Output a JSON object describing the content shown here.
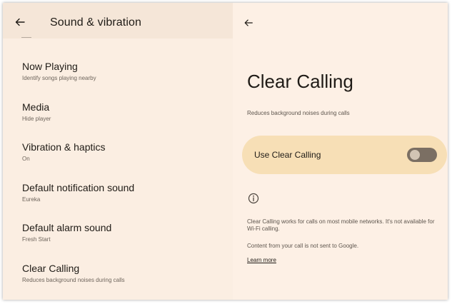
{
  "left_pane": {
    "title": "Sound & vibration",
    "items": [
      {
        "title": "Now Playing",
        "subtitle": "Identify songs playing nearby"
      },
      {
        "title": "Media",
        "subtitle": "Hide player"
      },
      {
        "title": "Vibration & haptics",
        "subtitle": "On"
      },
      {
        "title": "Default notification sound",
        "subtitle": "Eureka"
      },
      {
        "title": "Default alarm sound",
        "subtitle": "Fresh Start"
      },
      {
        "title": "Clear Calling",
        "subtitle": "Reduces background noises during calls"
      }
    ]
  },
  "right_pane": {
    "title": "Clear Calling",
    "description": "Reduces background noises during calls",
    "toggle": {
      "label": "Use Clear Calling",
      "state": "off"
    },
    "info_text": "Clear Calling works for calls on most mobile networks. It's not available for Wi-Fi calling.",
    "info_text_2": "Content from your call is not sent to Google.",
    "learn_more": "Learn more"
  },
  "icons": {
    "back": "arrow-back-icon",
    "info": "info-icon"
  },
  "colors": {
    "background": "#fbeee2",
    "header": "#f5e6d8",
    "toggle_card": "#f7dfb6",
    "switch_track": "#7b6f63"
  }
}
